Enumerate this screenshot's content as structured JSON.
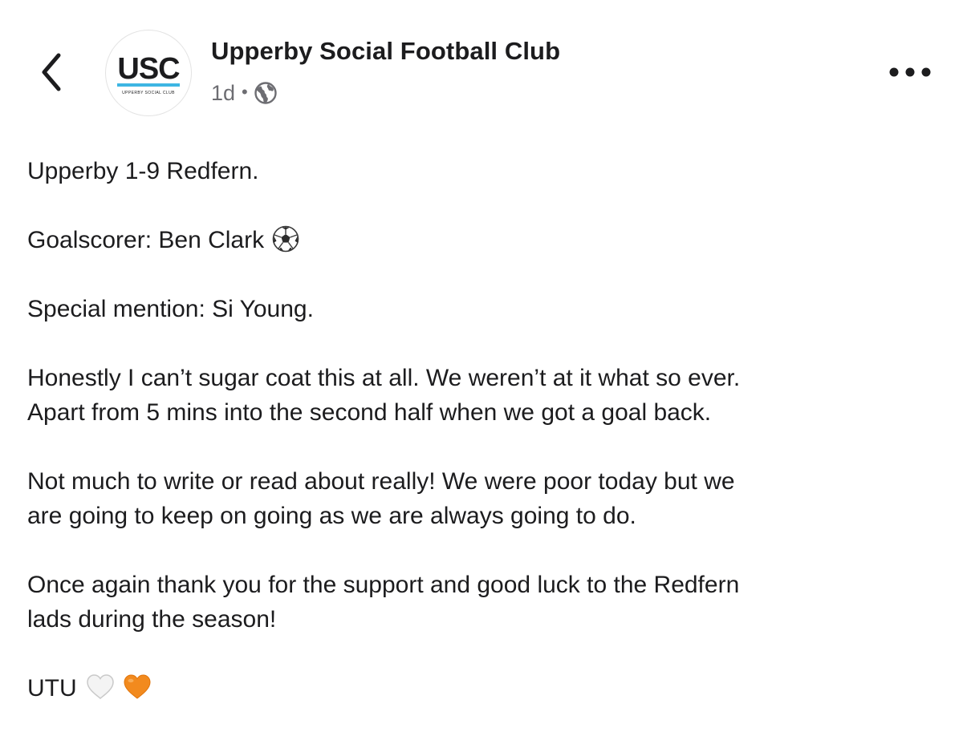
{
  "header": {
    "back_icon": "chevron-left-icon",
    "avatar": {
      "monogram": "USC",
      "ring_text": "UPPERBY SOCIAL CLUB",
      "underline_color": "#3db6e3"
    },
    "page_name": "Upperby Social Football Club",
    "timestamp": "1d",
    "separator": "•",
    "audience_icon": "globe-icon",
    "more_icon": "more-horizontal-icon"
  },
  "post": {
    "paragraphs": [
      {
        "text": "Upperby 1-9 Redfern."
      },
      {
        "text": "Goalscorer: Ben Clark",
        "emoji": "soccer-ball-icon"
      },
      {
        "text": "Special mention: Si Young."
      },
      {
        "lines": [
          "Honestly I can’t sugar coat this at all. We weren’t at it what so ever.",
          "Apart from 5 mins into the second half when we got a goal back."
        ]
      },
      {
        "lines": [
          "Not much to write or read about really! We were poor today but we",
          "are going to keep on going as we are always going to do."
        ]
      },
      {
        "lines": [
          "Once again thank you for the support and good luck to the Redfern",
          "lads during the season!"
        ]
      },
      {
        "text": "UTU",
        "emojis": [
          "white-heart-icon",
          "orange-heart-icon"
        ]
      }
    ]
  },
  "colors": {
    "text": "#1c1c1e",
    "meta_text": "#6d6d72",
    "orange_heart": "#f28a1e"
  }
}
